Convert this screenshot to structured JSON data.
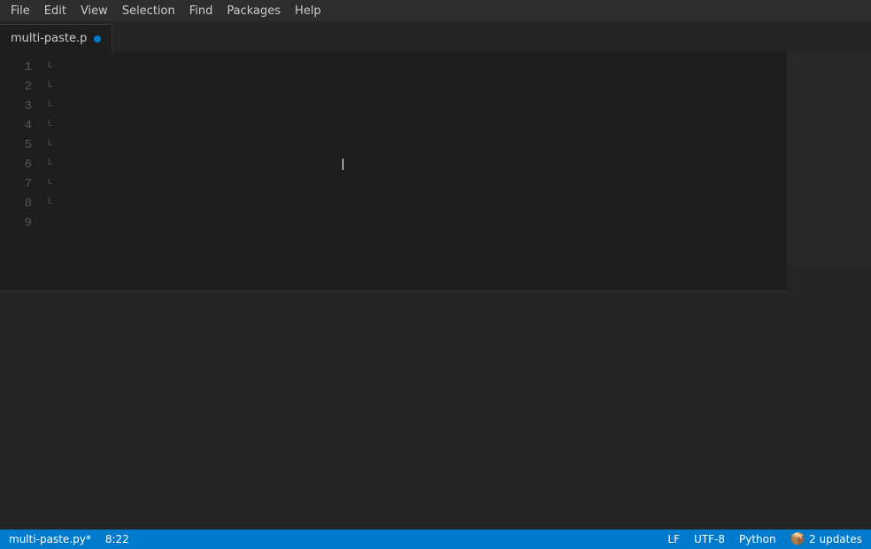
{
  "menubar": {
    "items": [
      "File",
      "Edit",
      "View",
      "Selection",
      "Find",
      "Packages",
      "Help"
    ]
  },
  "tabbar": {
    "tab": {
      "label": "multi-paste.p",
      "has_dot": true
    }
  },
  "editor": {
    "lines": [
      {
        "number": "1",
        "content": ""
      },
      {
        "number": "2",
        "content": ""
      },
      {
        "number": "3",
        "content": ""
      },
      {
        "number": "4",
        "content": ""
      },
      {
        "number": "5",
        "content": ""
      },
      {
        "number": "6",
        "content": ""
      },
      {
        "number": "7",
        "content": ""
      },
      {
        "number": "8",
        "content": ""
      },
      {
        "number": "9",
        "content": ""
      }
    ]
  },
  "statusbar": {
    "filename": "multi-paste.py*",
    "position": "8:22",
    "encoding": "LF",
    "charset": "UTF-8",
    "language": "Python",
    "updates": "2 updates"
  }
}
